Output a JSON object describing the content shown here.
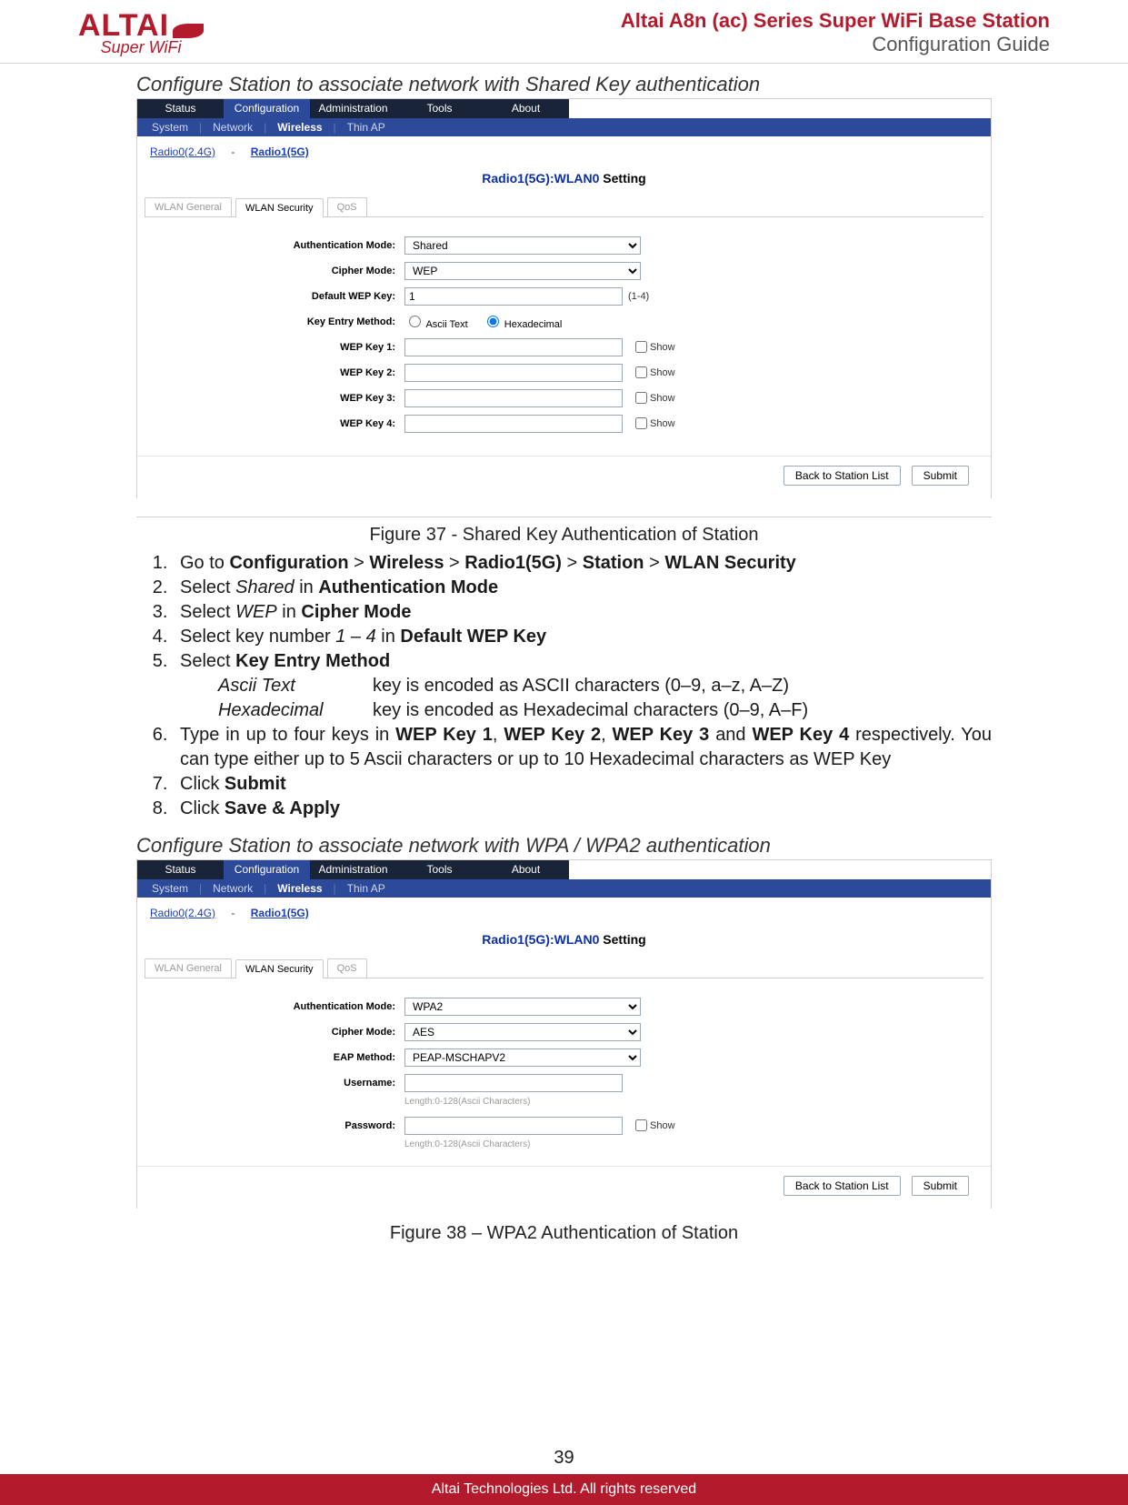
{
  "header": {
    "logo_text": "ALTAI",
    "logo_sub": "Super WiFi",
    "title1": "Altai A8n (ac) Series Super WiFi Base Station",
    "title2": "Configuration Guide"
  },
  "section1": {
    "title": "Configure Station to associate network with Shared Key authentication",
    "caption": "Figure 37 - Shared Key Authentication of Station"
  },
  "ui_common": {
    "tabs": [
      "Status",
      "Configuration",
      "Administration",
      "Tools",
      "About"
    ],
    "active_tab": "Configuration",
    "subnav": [
      "System",
      "Network",
      "Wireless",
      "Thin AP"
    ],
    "subnav_active": "Wireless",
    "radio_links": {
      "r0": "Radio0(2.4G)",
      "r1": "Radio1(5G)"
    },
    "sheet_prefix": "Radio1(5G):WLAN0",
    "sheet_suffix": " Setting",
    "innertabs": [
      "WLAN General",
      "WLAN Security",
      "QoS"
    ],
    "innertab_active": "WLAN Security",
    "btn_back": "Back to Station List",
    "btn_submit": "Submit",
    "show_label": "Show"
  },
  "ui1": {
    "labels": {
      "auth": "Authentication Mode:",
      "cipher": "Cipher Mode:",
      "defkey": "Default WEP Key:",
      "keymethod": "Key Entry Method:",
      "wep1": "WEP Key 1:",
      "wep2": "WEP Key 2:",
      "wep3": "WEP Key 3:",
      "wep4": "WEP Key 4:"
    },
    "values": {
      "auth": "Shared",
      "cipher": "WEP",
      "defkey": "1",
      "defkey_after": "(1-4)",
      "ascii": "Ascii Text",
      "hex": "Hexadecimal"
    }
  },
  "steps1": {
    "s1a": "Go to ",
    "s1b": "Configuration",
    "s1c": " > ",
    "s1d": "Wireless",
    "s1e": " > ",
    "s1f": "Radio1(5G)",
    "s1g": " > ",
    "s1h": "Station",
    "s1i": " > ",
    "s1j": "WLAN Security",
    "s2a": "Select ",
    "s2b": "Shared",
    "s2c": " in ",
    "s2d": "Authentication Mode",
    "s3a": "Select ",
    "s3b": "WEP",
    "s3c": " in ",
    "s3d": "Cipher Mode",
    "s4a": "Select key number ",
    "s4b": "1 – 4",
    "s4c": " in ",
    "s4d": "Default WEP Key",
    "s5a": "Select ",
    "s5b": "Key Entry Method",
    "s5_ascii_k": "Ascii Text",
    "s5_ascii_v": "key is encoded as ASCII characters (0–9, a–z, A–Z)",
    "s5_hex_k": "Hexadecimal",
    "s5_hex_v": "key is encoded as Hexadecimal characters (0–9, A–F)",
    "s6a": "Type in up to four keys in ",
    "s6b": "WEP Key 1",
    "s6c": ", ",
    "s6d": "WEP Key 2",
    "s6e": ", ",
    "s6f": "WEP Key 3",
    "s6g": " and ",
    "s6h": "WEP Key 4",
    "s6i": " respectively. You can type either up to 5 Ascii characters or up to 10 Hexadecimal characters as WEP Key",
    "s7a": "Click ",
    "s7b": "Submit",
    "s8a": "Click ",
    "s8b": "Save & Apply"
  },
  "section2": {
    "title": "Configure Station to associate network with WPA / WPA2 authentication",
    "caption": "Figure 38 – WPA2 Authentication of Station"
  },
  "ui2": {
    "labels": {
      "auth": "Authentication Mode:",
      "cipher": "Cipher Mode:",
      "eap": "EAP Method:",
      "user": "Username:",
      "pass": "Password:"
    },
    "values": {
      "auth": "WPA2",
      "cipher": "AES",
      "eap": "PEAP-MSCHAPV2",
      "len_hint": "Length:0-128(Ascii Characters)"
    }
  },
  "footer": {
    "page_num": "39",
    "copyright": "Altai Technologies Ltd. All rights reserved"
  }
}
